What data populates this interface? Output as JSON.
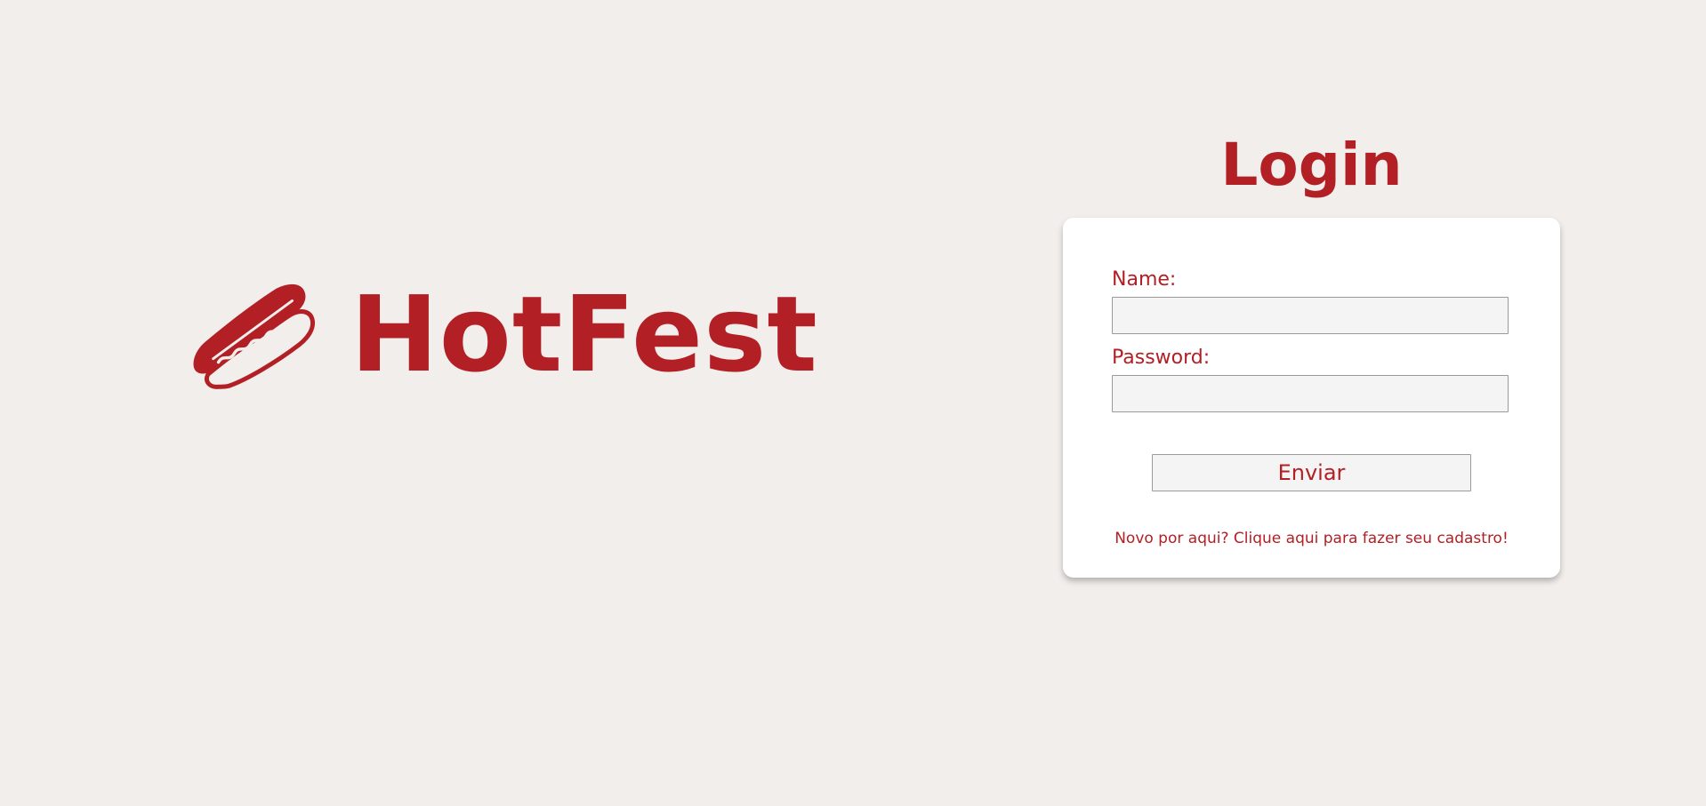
{
  "brand": {
    "name": "HotFest",
    "logo_icon": "hotdog-icon",
    "color": "#b21f24"
  },
  "login": {
    "title": "Login",
    "name_label": "Name:",
    "name_value": "",
    "password_label": "Password:",
    "password_value": "",
    "submit_label": "Enviar",
    "signup_link": "Novo por aqui? Clique aqui para fazer seu cadastro!"
  },
  "colors": {
    "background": "#f1eeec",
    "accent": "#b21f24",
    "card": "#ffffff",
    "input_bg": "#f4f4f4"
  }
}
